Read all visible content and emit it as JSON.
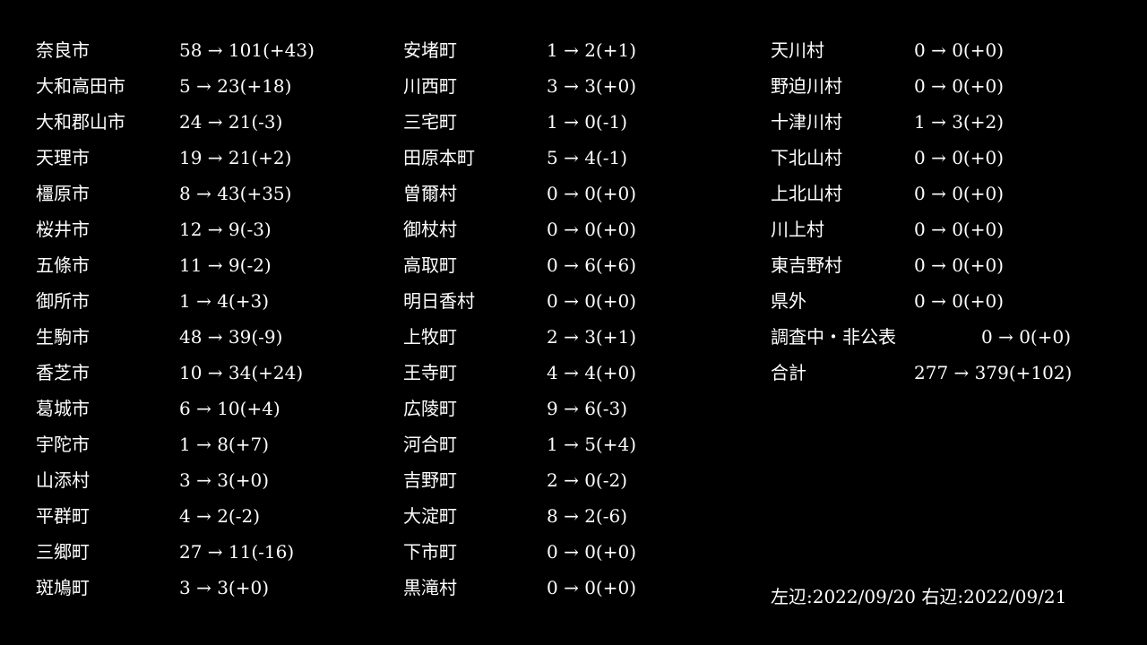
{
  "columns": [
    [
      {
        "name": "奈良市",
        "value": "58 → 101(+43)"
      },
      {
        "name": "大和高田市",
        "value": "5 → 23(+18)"
      },
      {
        "name": "大和郡山市",
        "value": "24 → 21(-3)"
      },
      {
        "name": "天理市",
        "value": "19 → 21(+2)"
      },
      {
        "name": "橿原市",
        "value": "8 → 43(+35)"
      },
      {
        "name": "桜井市",
        "value": "12 → 9(-3)"
      },
      {
        "name": "五條市",
        "value": "11 → 9(-2)"
      },
      {
        "name": "御所市",
        "value": "1 → 4(+3)"
      },
      {
        "name": "生駒市",
        "value": "48 → 39(-9)"
      },
      {
        "name": "香芝市",
        "value": "10 → 34(+24)"
      },
      {
        "name": "葛城市",
        "value": "6 → 10(+4)"
      },
      {
        "name": "宇陀市",
        "value": "1 → 8(+7)"
      },
      {
        "name": "山添村",
        "value": "3 → 3(+0)"
      },
      {
        "name": "平群町",
        "value": "4 → 2(-2)"
      },
      {
        "name": "三郷町",
        "value": "27 → 11(-16)"
      },
      {
        "name": "斑鳩町",
        "value": "3 → 3(+0)"
      }
    ],
    [
      {
        "name": "安堵町",
        "value": "1 → 2(+1)"
      },
      {
        "name": "川西町",
        "value": "3 → 3(+0)"
      },
      {
        "name": "三宅町",
        "value": "1 → 0(-1)"
      },
      {
        "name": "田原本町",
        "value": "5 → 4(-1)"
      },
      {
        "name": "曽爾村",
        "value": "0 → 0(+0)"
      },
      {
        "name": "御杖村",
        "value": "0 → 0(+0)"
      },
      {
        "name": "高取町",
        "value": "0 → 6(+6)"
      },
      {
        "name": "明日香村",
        "value": "0 → 0(+0)"
      },
      {
        "name": "上牧町",
        "value": "2 → 3(+1)"
      },
      {
        "name": "王寺町",
        "value": "4 → 4(+0)"
      },
      {
        "name": "広陵町",
        "value": "9 → 6(-3)"
      },
      {
        "name": "河合町",
        "value": "1 → 5(+4)"
      },
      {
        "name": "吉野町",
        "value": "2 → 0(-2)"
      },
      {
        "name": "大淀町",
        "value": "8 → 2(-6)"
      },
      {
        "name": "下市町",
        "value": "0 → 0(+0)"
      },
      {
        "name": "黒滝村",
        "value": "0 → 0(+0)"
      }
    ],
    [
      {
        "name": "天川村",
        "value": "0 → 0(+0)"
      },
      {
        "name": "野迫川村",
        "value": "0 → 0(+0)"
      },
      {
        "name": "十津川村",
        "value": "1 → 3(+2)"
      },
      {
        "name": "下北山村",
        "value": "0 → 0(+0)"
      },
      {
        "name": "上北山村",
        "value": "0 → 0(+0)"
      },
      {
        "name": "川上村",
        "value": "0 → 0(+0)"
      },
      {
        "name": "東吉野村",
        "value": "0 → 0(+0)"
      },
      {
        "name": "県外",
        "value": "0 → 0(+0)"
      },
      {
        "name": "調査中・非公表",
        "value": "0 → 0(+0)"
      },
      {
        "name": "合計",
        "value": "277 → 379(+102)"
      }
    ]
  ],
  "footer": "左辺:2022/09/20 右辺:2022/09/21",
  "colors": {
    "background": "#000000",
    "text": "#ffffff"
  }
}
